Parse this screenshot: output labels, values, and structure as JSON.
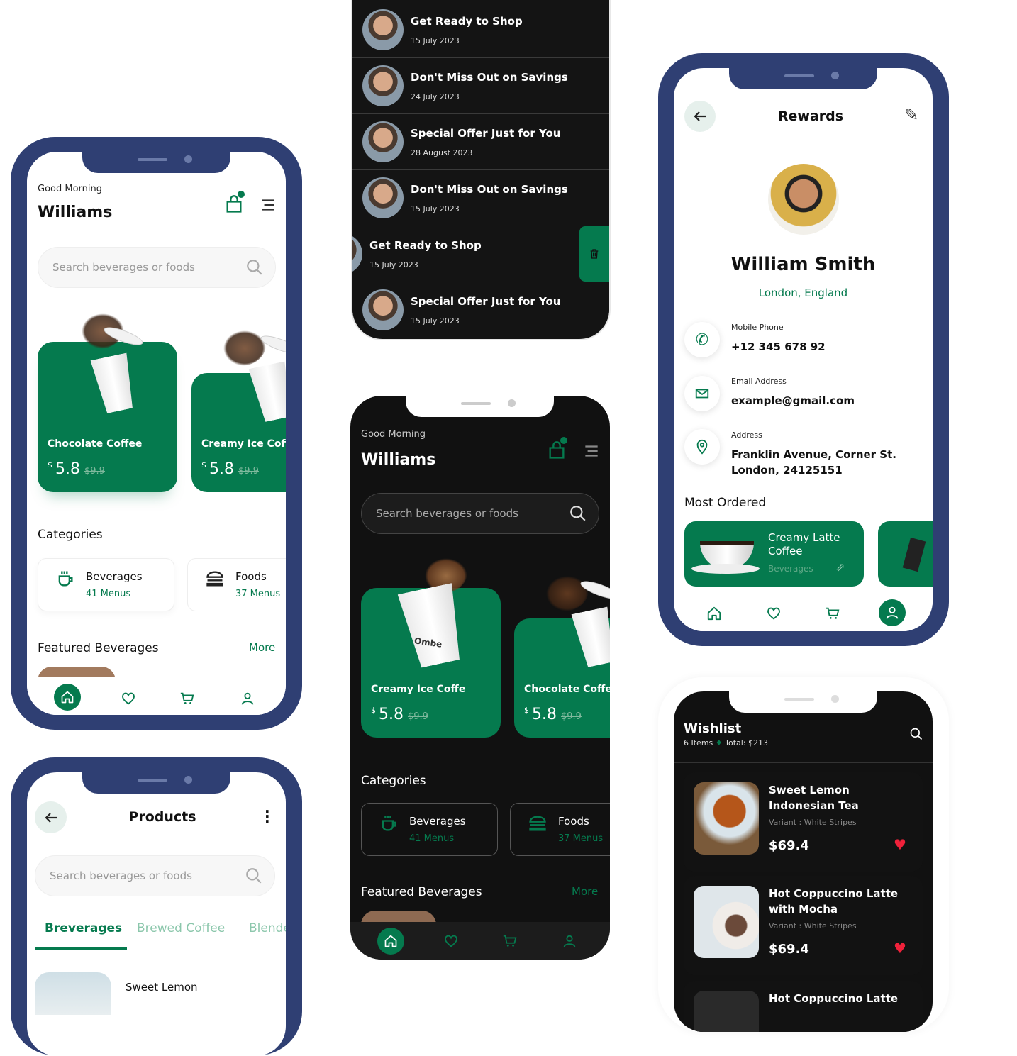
{
  "colors": {
    "brand_green": "#057a4e",
    "frame_navy": "#2f3f73",
    "dark_bg": "#111111",
    "heart_red": "#f0213a"
  },
  "home_light": {
    "greeting": "Good Morning",
    "name": "Williams",
    "search_placeholder": "Search beverages or foods",
    "products": [
      {
        "name": "Chocolate Coffee",
        "currency": "$",
        "price": "5.8",
        "old_price": "$9.9"
      },
      {
        "name": "Creamy Ice Coffe",
        "currency": "$",
        "price": "5.8",
        "old_price": "$9.9"
      }
    ],
    "categories_title": "Categories",
    "categories": [
      {
        "name": "Beverages",
        "count": "41 Menus",
        "icon": "cup-icon"
      },
      {
        "name": "Foods",
        "count": "37 Menus",
        "icon": "burger-icon"
      }
    ],
    "featured_title": "Featured Beverages",
    "more": "More"
  },
  "notifications": [
    {
      "title": "Get Ready to Shop",
      "date": "15 July 2023"
    },
    {
      "title": "Don't Miss Out on Savings",
      "date": "24 July 2023"
    },
    {
      "title": "Special Offer Just for You",
      "date": "28 August 2023"
    },
    {
      "title": "Don't Miss Out on Savings",
      "date": "15 July 2023"
    },
    {
      "title": "Get Ready to Shop",
      "date": "15 July 2023"
    },
    {
      "title": "Special Offer Just for You",
      "date": "15 July 2023"
    }
  ],
  "home_dark": {
    "greeting": "Good Morning",
    "name": "Williams",
    "search_placeholder": "Search beverages or foods",
    "cup_brand": "Ombe",
    "products": [
      {
        "name": "Creamy Ice Coffe",
        "currency": "$",
        "price": "5.8",
        "old_price": "$9.9"
      },
      {
        "name": "Chocolate Coffe",
        "currency": "$",
        "price": "5.8",
        "old_price": "$9.9"
      }
    ],
    "categories_title": "Categories",
    "categories": [
      {
        "name": "Beverages",
        "count": "41 Menus"
      },
      {
        "name": "Foods",
        "count": "37 Menus"
      }
    ],
    "featured_title": "Featured Beverages",
    "more": "More"
  },
  "rewards": {
    "title": "Rewards",
    "name": "William Smith",
    "location": "London, England",
    "mobile_label": "Mobile Phone",
    "mobile": "+12 345 678 92",
    "email_label": "Email Address",
    "email": "example@gmail.com",
    "address_label": "Address",
    "address_line1": "Franklin Avenue, Corner St.",
    "address_line2": "London, 24125151",
    "most_ordered_title": "Most Ordered",
    "most_ordered": [
      {
        "name_line1": "Creamy Latte",
        "name_line2": "Coffee",
        "category": "Beverages"
      }
    ]
  },
  "products_page": {
    "title": "Products",
    "search_placeholder": "Search beverages or foods",
    "tabs": [
      {
        "label": "Breverages",
        "active": true
      },
      {
        "label": "Brewed Coffee",
        "active": false
      },
      {
        "label": "Blended",
        "active": false
      }
    ],
    "first_item": "Sweet Lemon"
  },
  "wishlist": {
    "title": "Wishlist",
    "count": "6 Items",
    "total": "Total: $213",
    "items": [
      {
        "name": "Sweet Lemon Indonesian Tea",
        "variant": "Variant : White Stripes",
        "price": "$69.4"
      },
      {
        "name": "Hot Coppuccino Latte with Mocha",
        "variant": "Variant : White Stripes",
        "price": "$69.4"
      },
      {
        "name": "Hot Coppuccino Latte",
        "variant": "",
        "price": ""
      }
    ]
  }
}
